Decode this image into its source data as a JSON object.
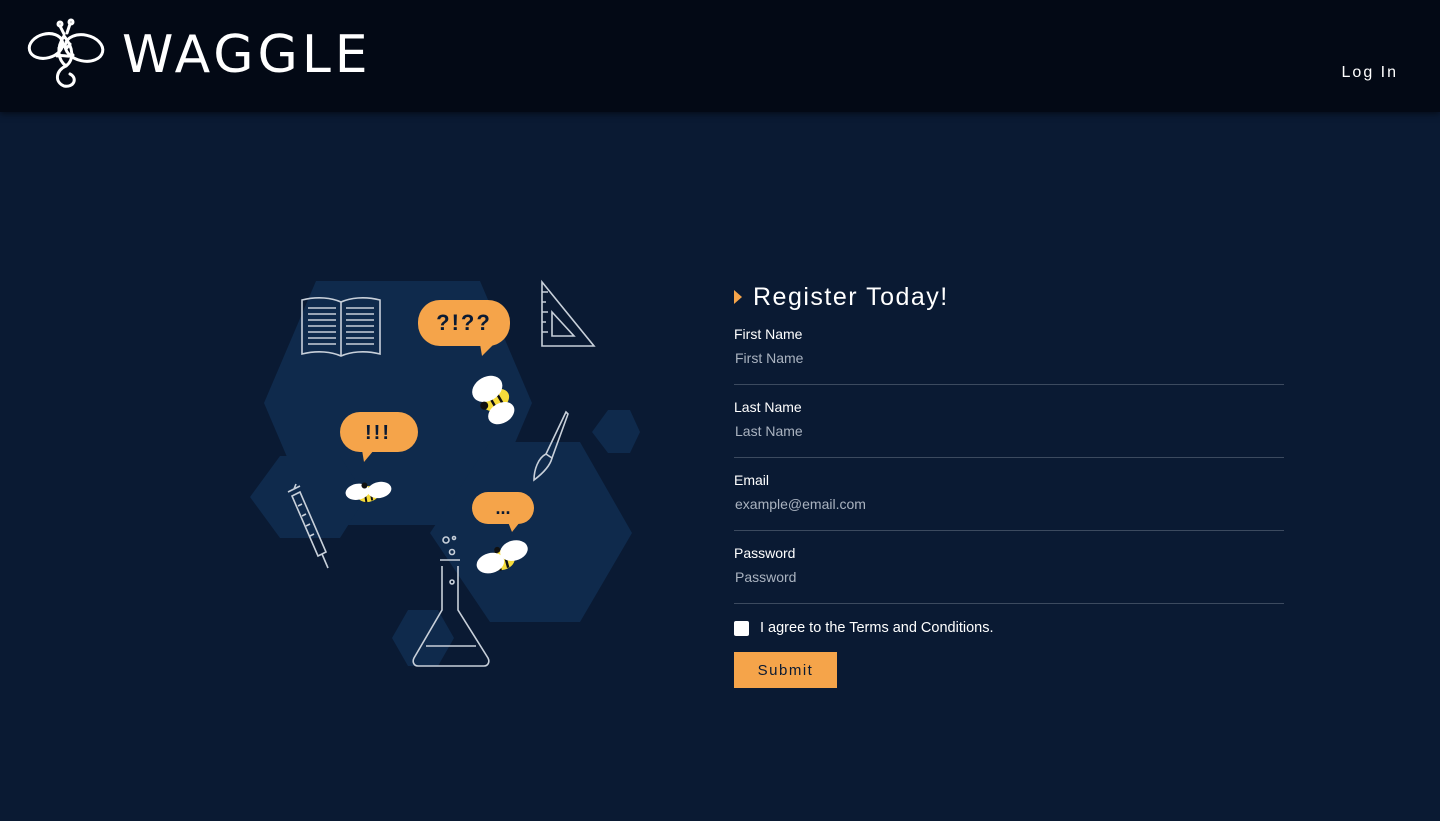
{
  "header": {
    "brand": "WAGGLE",
    "login_label": "Log In",
    "logo_icon": "bee-logo-icon"
  },
  "illustration": {
    "bubble_question": "?!??",
    "bubble_exclaim": "!!!",
    "bubble_ellipsis": "...",
    "icons": [
      "book-icon",
      "set-square-icon",
      "paintbrush-icon",
      "syringe-icon",
      "flask-icon",
      "bee-icon"
    ]
  },
  "register": {
    "title": "Register Today!",
    "fields": [
      {
        "label": "First Name",
        "placeholder": "First Name",
        "value": ""
      },
      {
        "label": "Last Name",
        "placeholder": "Last Name",
        "value": ""
      },
      {
        "label": "Email",
        "placeholder": "example@email.com",
        "value": ""
      },
      {
        "label": "Password",
        "placeholder": "Password",
        "value": ""
      }
    ],
    "terms_label": "I agree to the Terms and Conditions.",
    "terms_checked": false,
    "submit_label": "Submit"
  },
  "colors": {
    "background": "#0a1a33",
    "header": "#030915",
    "accent": "#f5a44a",
    "hexagon": "#0f2a4c",
    "bee_yellow": "#f6dc3c"
  }
}
